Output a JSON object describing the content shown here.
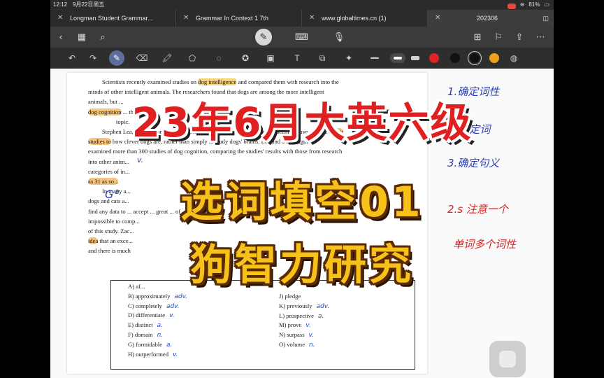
{
  "status": {
    "time": "12:12",
    "date": "9月22日周五",
    "battery": "81%"
  },
  "tabs": [
    {
      "label": "Longman Student Grammar...",
      "active": false
    },
    {
      "label": "Grammar In Context 1 7th",
      "active": false
    },
    {
      "label": "www.globaltimes.cn (1)",
      "active": false
    },
    {
      "label": "202306",
      "active": true
    }
  ],
  "toolbar_colors": {
    "red": "#e02424",
    "black": "#111111",
    "orange": "#f0a020",
    "accent": "#5c6f9c"
  },
  "passage": [
    "Scientists recently examined studies on dog intelligence and compared them with research into the minds of other intelligent animals. The researchers found that dogs are among the more intelligent animals...",
    "Stephen Lea, lead author of the new study, argues that many researchers seem to have designed their studies to how clever dogs are, rather than simply to study dogs' brains. Lea and a colleague examined more than 300 studies of dog cognition, comparing the studies' results with those from research into other animals.",
    "In many a ... dogs and cats a ... find any data to ... impossible to comp... of this study. Zac... idea that an exce... and there is much ..."
  ],
  "passage_fragments": {
    "l1_a": "Scientists recently examined studies on ",
    "l1_hl": "dog intelligence",
    "l1_b": " and compared them with research into the",
    "l2": "minds of other intelligent animals. The researchers found that dogs are among the more intelligent",
    "l3": "animals, but ...",
    "l4_hl": "dog cognition",
    "l4_b": "     ...  this  ...  of  ...",
    "l5": "topic.",
    "l6_a": "Stephen Lea, lead author of the new study, argues that many researchers seem to have designed ",
    "l6_hl": "their",
    "l7_hl": "studies to",
    "l7_b": "      how clever dogs are, rather than simply to study dogs' brains. Lea and a colleague",
    "l8": "examined more than 300 studies of dog cognition, comparing the studies' results with those from research",
    "l9": "into other anim...",
    "l10": "categories of in...",
    "l11_hl": "as  31  as so...",
    "l12": "In many a...",
    "l13": "dogs and cats a...",
    "l14": "find any data to ... accept ... great ... of ... so it was",
    "l15": "impossible to comp...",
    "l16": "of this study. Zac...",
    "l17_hl": "idea",
    "l17_b": " that an exce...",
    "l18": "and there is much"
  },
  "options_left": [
    {
      "letter": "A)",
      "word": "af...",
      "pos": ""
    },
    {
      "letter": "B)",
      "word": "approximately",
      "pos": "adv."
    },
    {
      "letter": "C)",
      "word": "completely",
      "pos": "adv."
    },
    {
      "letter": "D)",
      "word": "differentiate",
      "pos": "v."
    },
    {
      "letter": "E)",
      "word": "distinct",
      "pos": "a."
    },
    {
      "letter": "F)",
      "word": "domain",
      "pos": "n."
    },
    {
      "letter": "G)",
      "word": "formidable",
      "pos": "a."
    },
    {
      "letter": "H)",
      "word": "outperformed",
      "pos": "v."
    }
  ],
  "options_right": [
    {
      "letter": "J)",
      "word": "pledge",
      "pos": ""
    },
    {
      "letter": "K)",
      "word": "previously",
      "pos": "adv."
    },
    {
      "letter": "L)",
      "word": "prospective",
      "pos": "a."
    },
    {
      "letter": "M)",
      "word": "prove",
      "pos": "v."
    },
    {
      "letter": "N)",
      "word": "surpass",
      "pos": "v."
    },
    {
      "letter": "O)",
      "word": "volume",
      "pos": "n."
    }
  ],
  "handwriting": {
    "step1": "1.确定词性",
    "step2": "2.确定词",
    "step3": "3.确定句义",
    "note": "2.s 注意一个",
    "note2": "单词多个词性",
    "margin_g": "G",
    "margin_a": "a.",
    "margin_v": "v."
  },
  "cover": {
    "title": "23年6月大英六级",
    "line1": "选词填空01",
    "line2": "狗智力研究"
  }
}
